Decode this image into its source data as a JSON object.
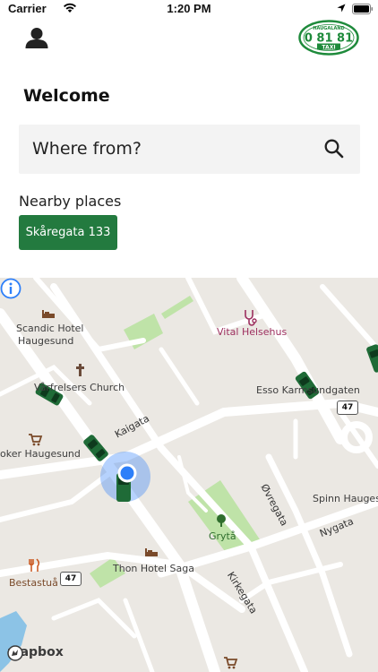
{
  "status_bar": {
    "carrier": "Carrier",
    "time": "1:20 PM"
  },
  "header": {
    "logo": {
      "top": "HAUGALAND",
      "number": "0 81 81",
      "bottom": "TAXI",
      "color": "#1e8a3b"
    }
  },
  "welcome": "Welcome",
  "search": {
    "placeholder": "Where from?"
  },
  "nearby": {
    "title": "Nearby places",
    "items": [
      {
        "label": "Skåregata 133"
      }
    ]
  },
  "colors": {
    "primary_green": "#237a3f",
    "map_bg": "#ebe8e3",
    "park_green": "#bfe3a8",
    "location_blue": "#2d7ff9"
  },
  "map": {
    "labels": {
      "scandic": "Scandic Hotel Haugesund",
      "vital": "Vital Helsehus",
      "church": "Vårfrelsers Church",
      "esso": "Esso Karmsundgaten",
      "joker": "oker Haugesund",
      "spinn": "Spinn Hauges",
      "gryta": "Grytå",
      "thon": "Thon Hotel Saga",
      "bestastua": "Bestastuå"
    },
    "streets": {
      "kaigata": "Kaigata",
      "ovregata": "Øvregata",
      "nygata": "Nygata",
      "kirkegata": "Kirkegata"
    },
    "road_shields": {
      "shield_1": "47",
      "shield_2": "47"
    },
    "attribution": "mapbox"
  }
}
